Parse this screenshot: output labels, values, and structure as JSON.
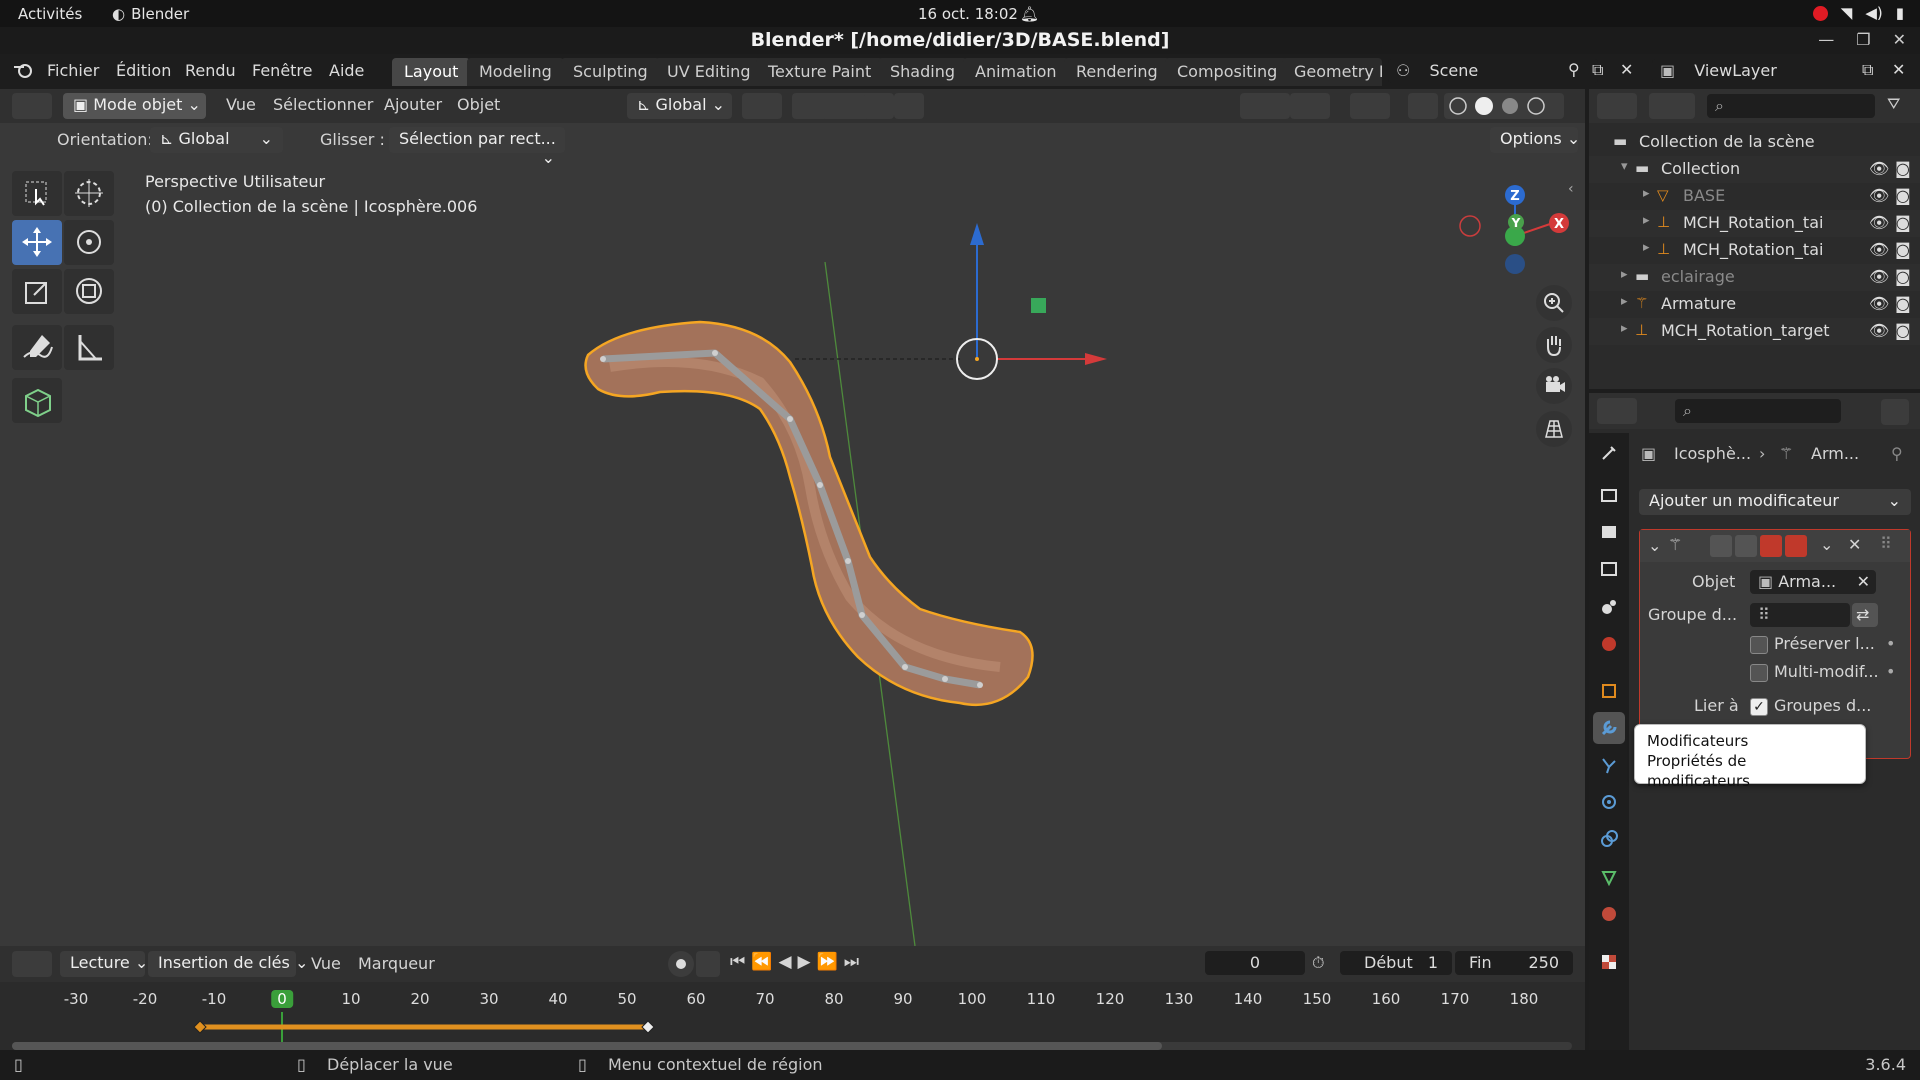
{
  "system": {
    "activities": "Activités",
    "app_name": "Blender",
    "clock": "16 oct.  18:02"
  },
  "window": {
    "title": "Blender* [/home/didier/3D/BASE.blend]"
  },
  "menu": {
    "items": [
      "Fichier",
      "Édition",
      "Rendu",
      "Fenêtre",
      "Aide"
    ],
    "workspaces": [
      "Layout",
      "Modeling",
      "Sculpting",
      "UV Editing",
      "Texture Paint",
      "Shading",
      "Animation",
      "Rendering",
      "Compositing",
      "Geometry N"
    ],
    "active_workspace": "Layout",
    "scene": "Scene",
    "view_layer": "ViewLayer"
  },
  "viewport": {
    "mode": "Mode objet",
    "menus": [
      "Vue",
      "Sélectionner",
      "Ajouter",
      "Objet"
    ],
    "transform_orientation": "Global",
    "orientation_label": "Orientation:",
    "orientation_value": "Global",
    "drag_label": "Glisser :",
    "drag_value": "Sélection par rect...",
    "options": "Options",
    "overlay_line1": "Perspective Utilisateur",
    "overlay_line2": "(0) Collection de la scène | Icosphère.006",
    "axis_z": "Z",
    "axis_y": "Y",
    "axis_x": "X"
  },
  "outliner": {
    "rows": [
      {
        "name": "Collection de la scène",
        "indent": 0,
        "icon": "scene-collection-icon",
        "dim": false
      },
      {
        "name": "Collection",
        "indent": 1,
        "icon": "collection-icon",
        "dim": false
      },
      {
        "name": "BASE",
        "indent": 2,
        "icon": "mesh-icon",
        "dim": true
      },
      {
        "name": "MCH_Rotation_tai",
        "indent": 2,
        "icon": "bone-icon",
        "dim": false
      },
      {
        "name": "MCH_Rotation_tai",
        "indent": 2,
        "icon": "bone-icon",
        "dim": false
      },
      {
        "name": "eclairage",
        "indent": 1,
        "icon": "collection-icon",
        "dim": true
      },
      {
        "name": "Armature",
        "indent": 1,
        "icon": "armature-icon",
        "dim": false
      },
      {
        "name": "MCH_Rotation_target",
        "indent": 1,
        "icon": "bone-icon",
        "dim": false
      }
    ]
  },
  "properties": {
    "breadcrumb_obj": "Icosphè...",
    "breadcrumb_mod": "Arm...",
    "add_modifier": "Ajouter un modificateur",
    "object_label": "Objet",
    "object_value": "Arma...",
    "vgroup_label": "Groupe d...",
    "preserve_label": "Préserver l...",
    "multi_label": "Multi-modif...",
    "bind_label": "Lier à",
    "bind_value": "Groupes d..."
  },
  "tooltip": {
    "title": "Modificateurs",
    "subtitle": "Propriétés de modificateurs"
  },
  "timeline": {
    "playback": "Lecture",
    "keying": "Insertion de clés",
    "view": "Vue",
    "marker": "Marqueur",
    "current_frame": "0",
    "start_label": "Début",
    "start": "1",
    "end_label": "Fin",
    "end": "250",
    "ruler": [
      "-30",
      "-20",
      "-10",
      "0",
      "10",
      "20",
      "30",
      "40",
      "50",
      "60",
      "70",
      "80",
      "90",
      "100",
      "110",
      "120",
      "130",
      "140",
      "150",
      "160",
      "170",
      "180"
    ]
  },
  "status": {
    "left": "Déplacer la vue",
    "mid": "Menu contextuel de région",
    "version": "3.6.4"
  },
  "colors": {
    "accent": "#4772b3",
    "selection_orange": "#f5a623",
    "active_green": "#3a9f3a",
    "mesh_fill": "#9b6d55"
  }
}
